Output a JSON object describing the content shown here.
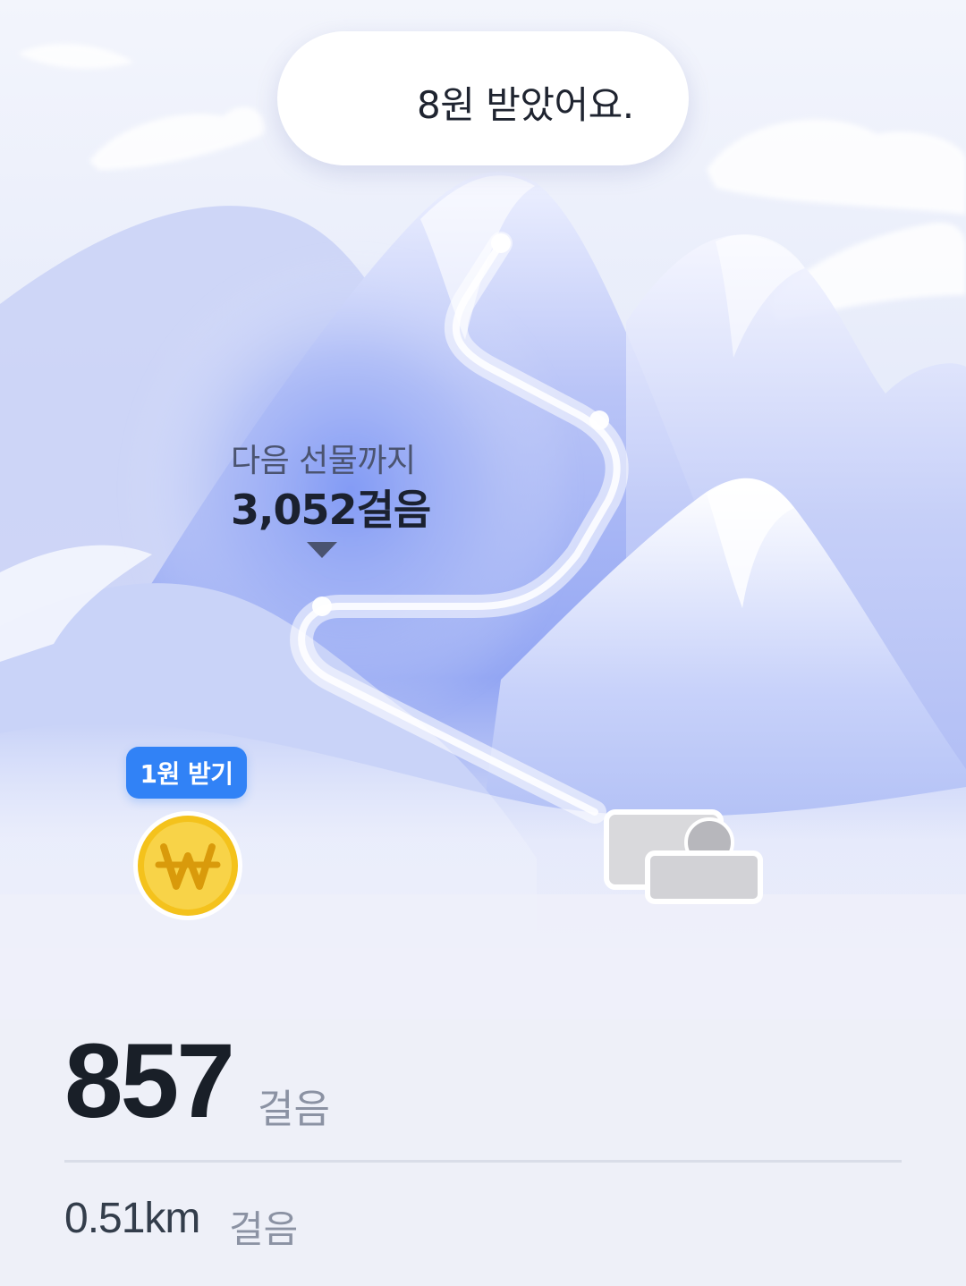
{
  "toast": {
    "icon": "party-popper-icon",
    "message": "8원 받았어요."
  },
  "next_gift": {
    "caption": "다음 선물까지",
    "steps": "3,052걸음"
  },
  "claim_badge": {
    "label": "1원 받기",
    "color": "#3182f6"
  },
  "coin": {
    "icon": "won-coin-icon",
    "color": "#f7c624"
  },
  "stats": {
    "steps_value": "857",
    "steps_unit": "걸음",
    "distance_value": "0.51km",
    "distance_unit": "걸음"
  }
}
